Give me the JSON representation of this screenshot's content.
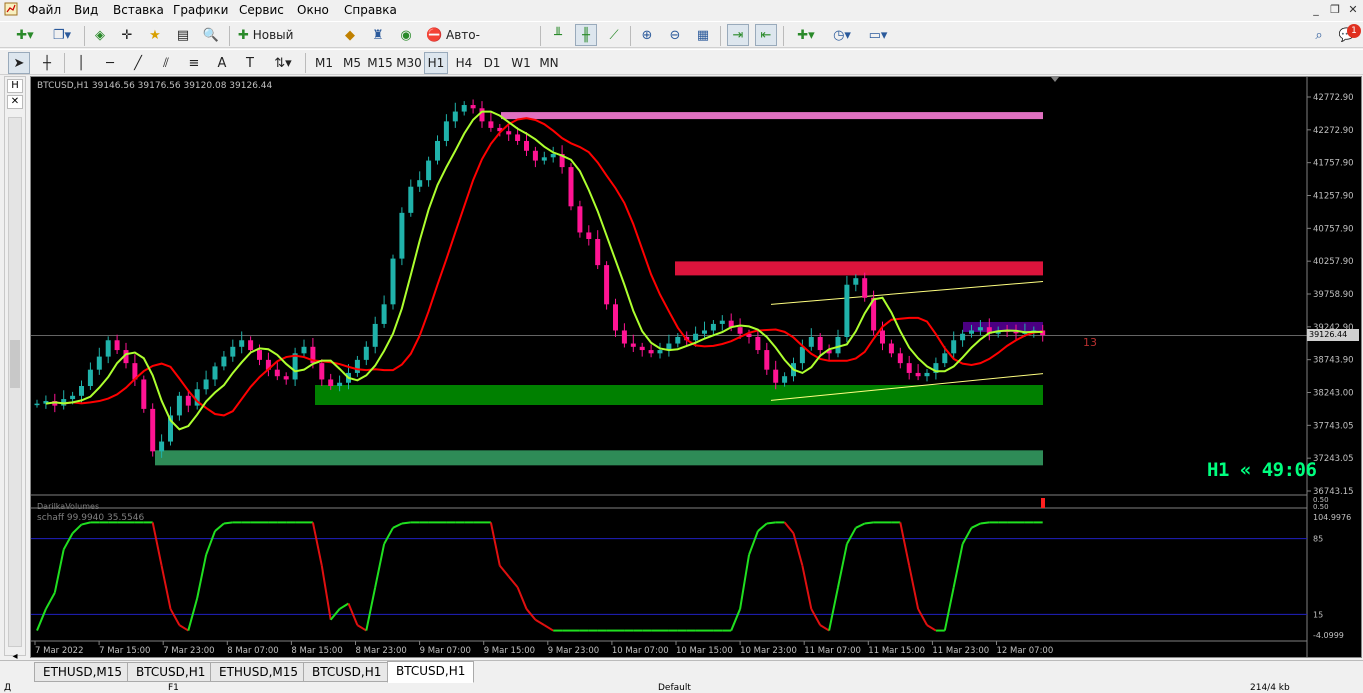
{
  "menubar": {
    "app_icon": "mt4-chart-icon",
    "items": [
      "Файл",
      "Вид",
      "Вставка",
      "Графики",
      "Сервис",
      "Окно",
      "Справка"
    ]
  },
  "toolbar1": {
    "new_order_label": "Новый ордер",
    "autotrading_label": "Авто-торговля",
    "notification_count": "1"
  },
  "toolbar2": {
    "timeframes": [
      "M1",
      "M5",
      "M15",
      "M30",
      "H1",
      "H4",
      "D1",
      "W1",
      "MN"
    ],
    "active_timeframe": "H1"
  },
  "chart": {
    "symbol_info": "BTCUSD,H1  39146.56 39176.56 39120.08 39126.44",
    "current_price": "39126.44",
    "timer": "H1  « 49:06",
    "right_label": "13",
    "volumes_indicator_label": "DarilkaVolumes",
    "schaff_label": "schaff 99.9940 35.5546",
    "colors": {
      "background": "#000000",
      "up_candle": "#20b2aa",
      "down_candle": "#ff1493",
      "fast_ma": "#adff2f",
      "slow_ma": "#ff0000",
      "resistance_zone_top": "#e070c0",
      "resistance_zone_mid": "#dc143c",
      "support_zone_mid": "#008000",
      "support_zone_low": "#2e8b57",
      "current_zone": "#4b0082",
      "grid_text": "#c0c0c0",
      "timer": "#00ff7f"
    },
    "price_axis": [
      "42772.90",
      "42272.90",
      "41757.90",
      "41257.90",
      "40757.90",
      "40257.90",
      "39758.90",
      "39242.90",
      "38743.90",
      "38243.00",
      "37743.05",
      "37243.05",
      "36743.15"
    ],
    "volume_axis": [
      "0.50",
      "0.50"
    ],
    "schaff_axis": [
      "104.9976",
      "85",
      "15",
      "-4.0999"
    ],
    "time_axis": [
      "7 Mar 2022",
      "7 Mar 15:00",
      "7 Mar 23:00",
      "8 Mar 07:00",
      "8 Mar 15:00",
      "8 Mar 23:00",
      "9 Mar 07:00",
      "9 Mar 15:00",
      "9 Mar 23:00",
      "10 Mar 07:00",
      "10 Mar 15:00",
      "10 Mar 23:00",
      "11 Mar 07:00",
      "11 Mar 15:00",
      "11 Mar 23:00",
      "12 Mar 07:00"
    ]
  },
  "tabs": [
    "ETHUSD,M15",
    "BTCUSD,H1",
    "ETHUSD,M15",
    "BTCUSD,H1",
    "BTCUSD,H1"
  ],
  "active_tab_index": 4,
  "statusbar": {
    "help": "Д",
    "f1": "F1",
    "profile": "Default",
    "traffic": "214/4 kb"
  }
}
